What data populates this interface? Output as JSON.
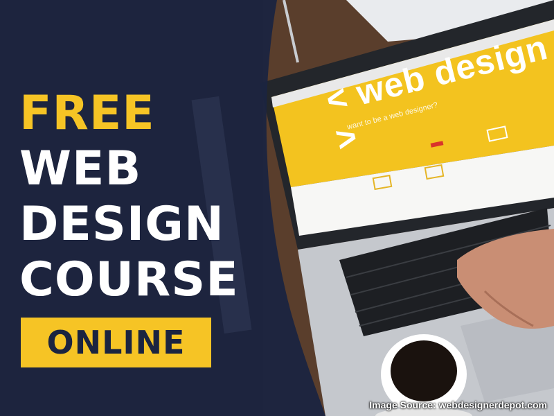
{
  "headline": {
    "line1": "FREE",
    "line2": "WEB",
    "line3": "DESIGN",
    "line4": "COURSE"
  },
  "badge": {
    "label": "ONLINE"
  },
  "screen": {
    "title": "< web design >",
    "subtitle": "want to be a web designer?"
  },
  "caption": "Image Source: webdesignerdepot.com",
  "colors": {
    "navy": "#1b2440",
    "accent_yellow": "#f6c425",
    "white": "#ffffff"
  },
  "icons": [
    "laptop-illustration",
    "coffee-cup-illustration",
    "hand-illustration",
    "ruler-illustration"
  ]
}
